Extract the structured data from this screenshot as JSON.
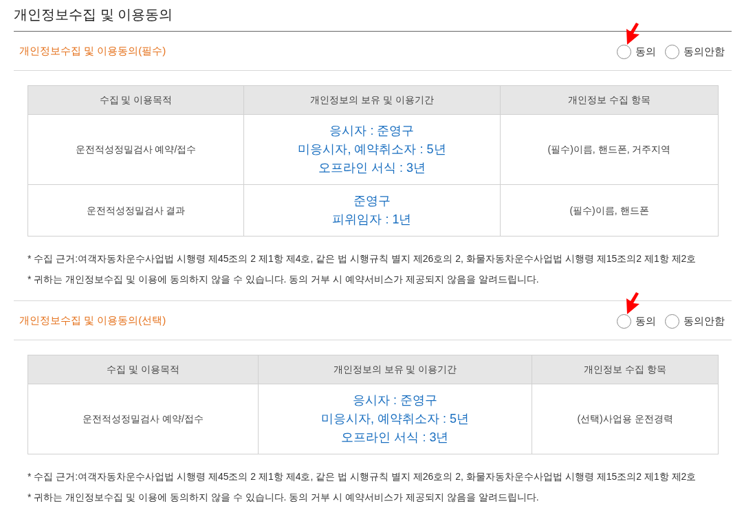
{
  "page": {
    "title": "개인정보수집 및 이용동의"
  },
  "sections": [
    {
      "heading": "개인정보수집 및 이용동의(필수)",
      "options": [
        {
          "label": "동의",
          "selected": false,
          "annotated": true
        },
        {
          "label": "동의안함",
          "selected": false,
          "annotated": false
        }
      ],
      "table": {
        "columns": [
          "수집 및 이용목적",
          "개인정보의 보유 및 이용기간",
          "개인정보 수집 항목"
        ],
        "rows": [
          {
            "purpose": "운전적성정밀검사 예약/접수",
            "retention": [
              "응시자 : 준영구",
              "미응시자, 예약취소자 : 5년",
              "오프라인 서식 : 3년"
            ],
            "items": "(필수)이름, 핸드폰, 거주지역"
          },
          {
            "purpose": "운전적성정밀검사 결과",
            "retention": [
              "준영구",
              "피위임자 : 1년"
            ],
            "items": "(필수)이름, 핸드폰"
          }
        ]
      },
      "notes": [
        "* 수집 근거:여객자동차운수사업법 시행령 제45조의 2 제1항 제4호, 같은 법 시행규칙 별지 제26호의 2, 화물자동차운수사업법 시행령 제15조의2 제1항 제2호",
        "* 귀하는 개인정보수집 및 이용에 동의하지 않을 수 있습니다. 동의 거부 시 예약서비스가 제공되지 않음을 알려드립니다."
      ]
    },
    {
      "heading": "개인정보수집 및 이용동의(선택)",
      "options": [
        {
          "label": "동의",
          "selected": false,
          "annotated": true
        },
        {
          "label": "동의안함",
          "selected": false,
          "annotated": false
        }
      ],
      "table": {
        "columns": [
          "수집 및 이용목적",
          "개인정보의 보유 및 이용기간",
          "개인정보 수집 항목"
        ],
        "rows": [
          {
            "purpose": "운전적성정밀검사 예약/접수",
            "retention": [
              "응시자 : 준영구",
              "미응시자, 예약취소자 : 5년",
              "오프라인 서식 : 3년"
            ],
            "items": "(선택)사업용 운전경력"
          }
        ]
      },
      "notes": [
        "* 수집 근거:여객자동차운수사업법 시행령 제45조의 2 제1항 제4호, 같은 법 시행규칙 별지 제26호의 2, 화물자동차운수사업법 시행령 제15조의2 제1항 제2호",
        "* 귀하는 개인정보수집 및 이용에 동의하지 않을 수 있습니다. 동의 거부 시 예약서비스가 제공되지 않음을 알려드립니다."
      ]
    }
  ]
}
